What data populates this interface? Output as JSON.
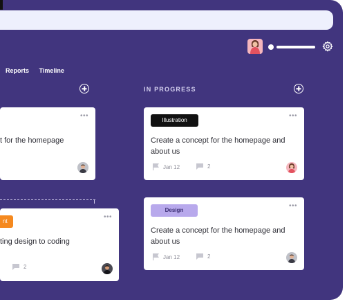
{
  "nav": {
    "items": [
      "Reports",
      "Timeline"
    ]
  },
  "columns": [
    {
      "title": ""
    },
    {
      "title": "IN PROGRESS"
    }
  ],
  "cards": [
    {
      "title": "t for the homepage",
      "tag": "",
      "date": "",
      "comments": ""
    },
    {
      "title": "ting design to coding",
      "tag": "nt",
      "date": "",
      "comments": "2"
    },
    {
      "title": "Create a concept for the homepage and about us",
      "tag": "Illustration",
      "date": "Jan 12",
      "comments": "2"
    },
    {
      "title": "Create a concept for the homepage and about us",
      "tag": "Design",
      "date": "Jan 12",
      "comments": "2"
    }
  ],
  "colors": {
    "board_bg": "#41357e",
    "search_bg": "#eef0fd",
    "tag_illustration": "#111111",
    "tag_design": "#b8a9ec",
    "tag_orange": "#f5891f"
  },
  "icons": [
    "gear-icon",
    "plus-circle-icon",
    "more-icon",
    "flag-icon",
    "comment-icon",
    "avatar"
  ]
}
